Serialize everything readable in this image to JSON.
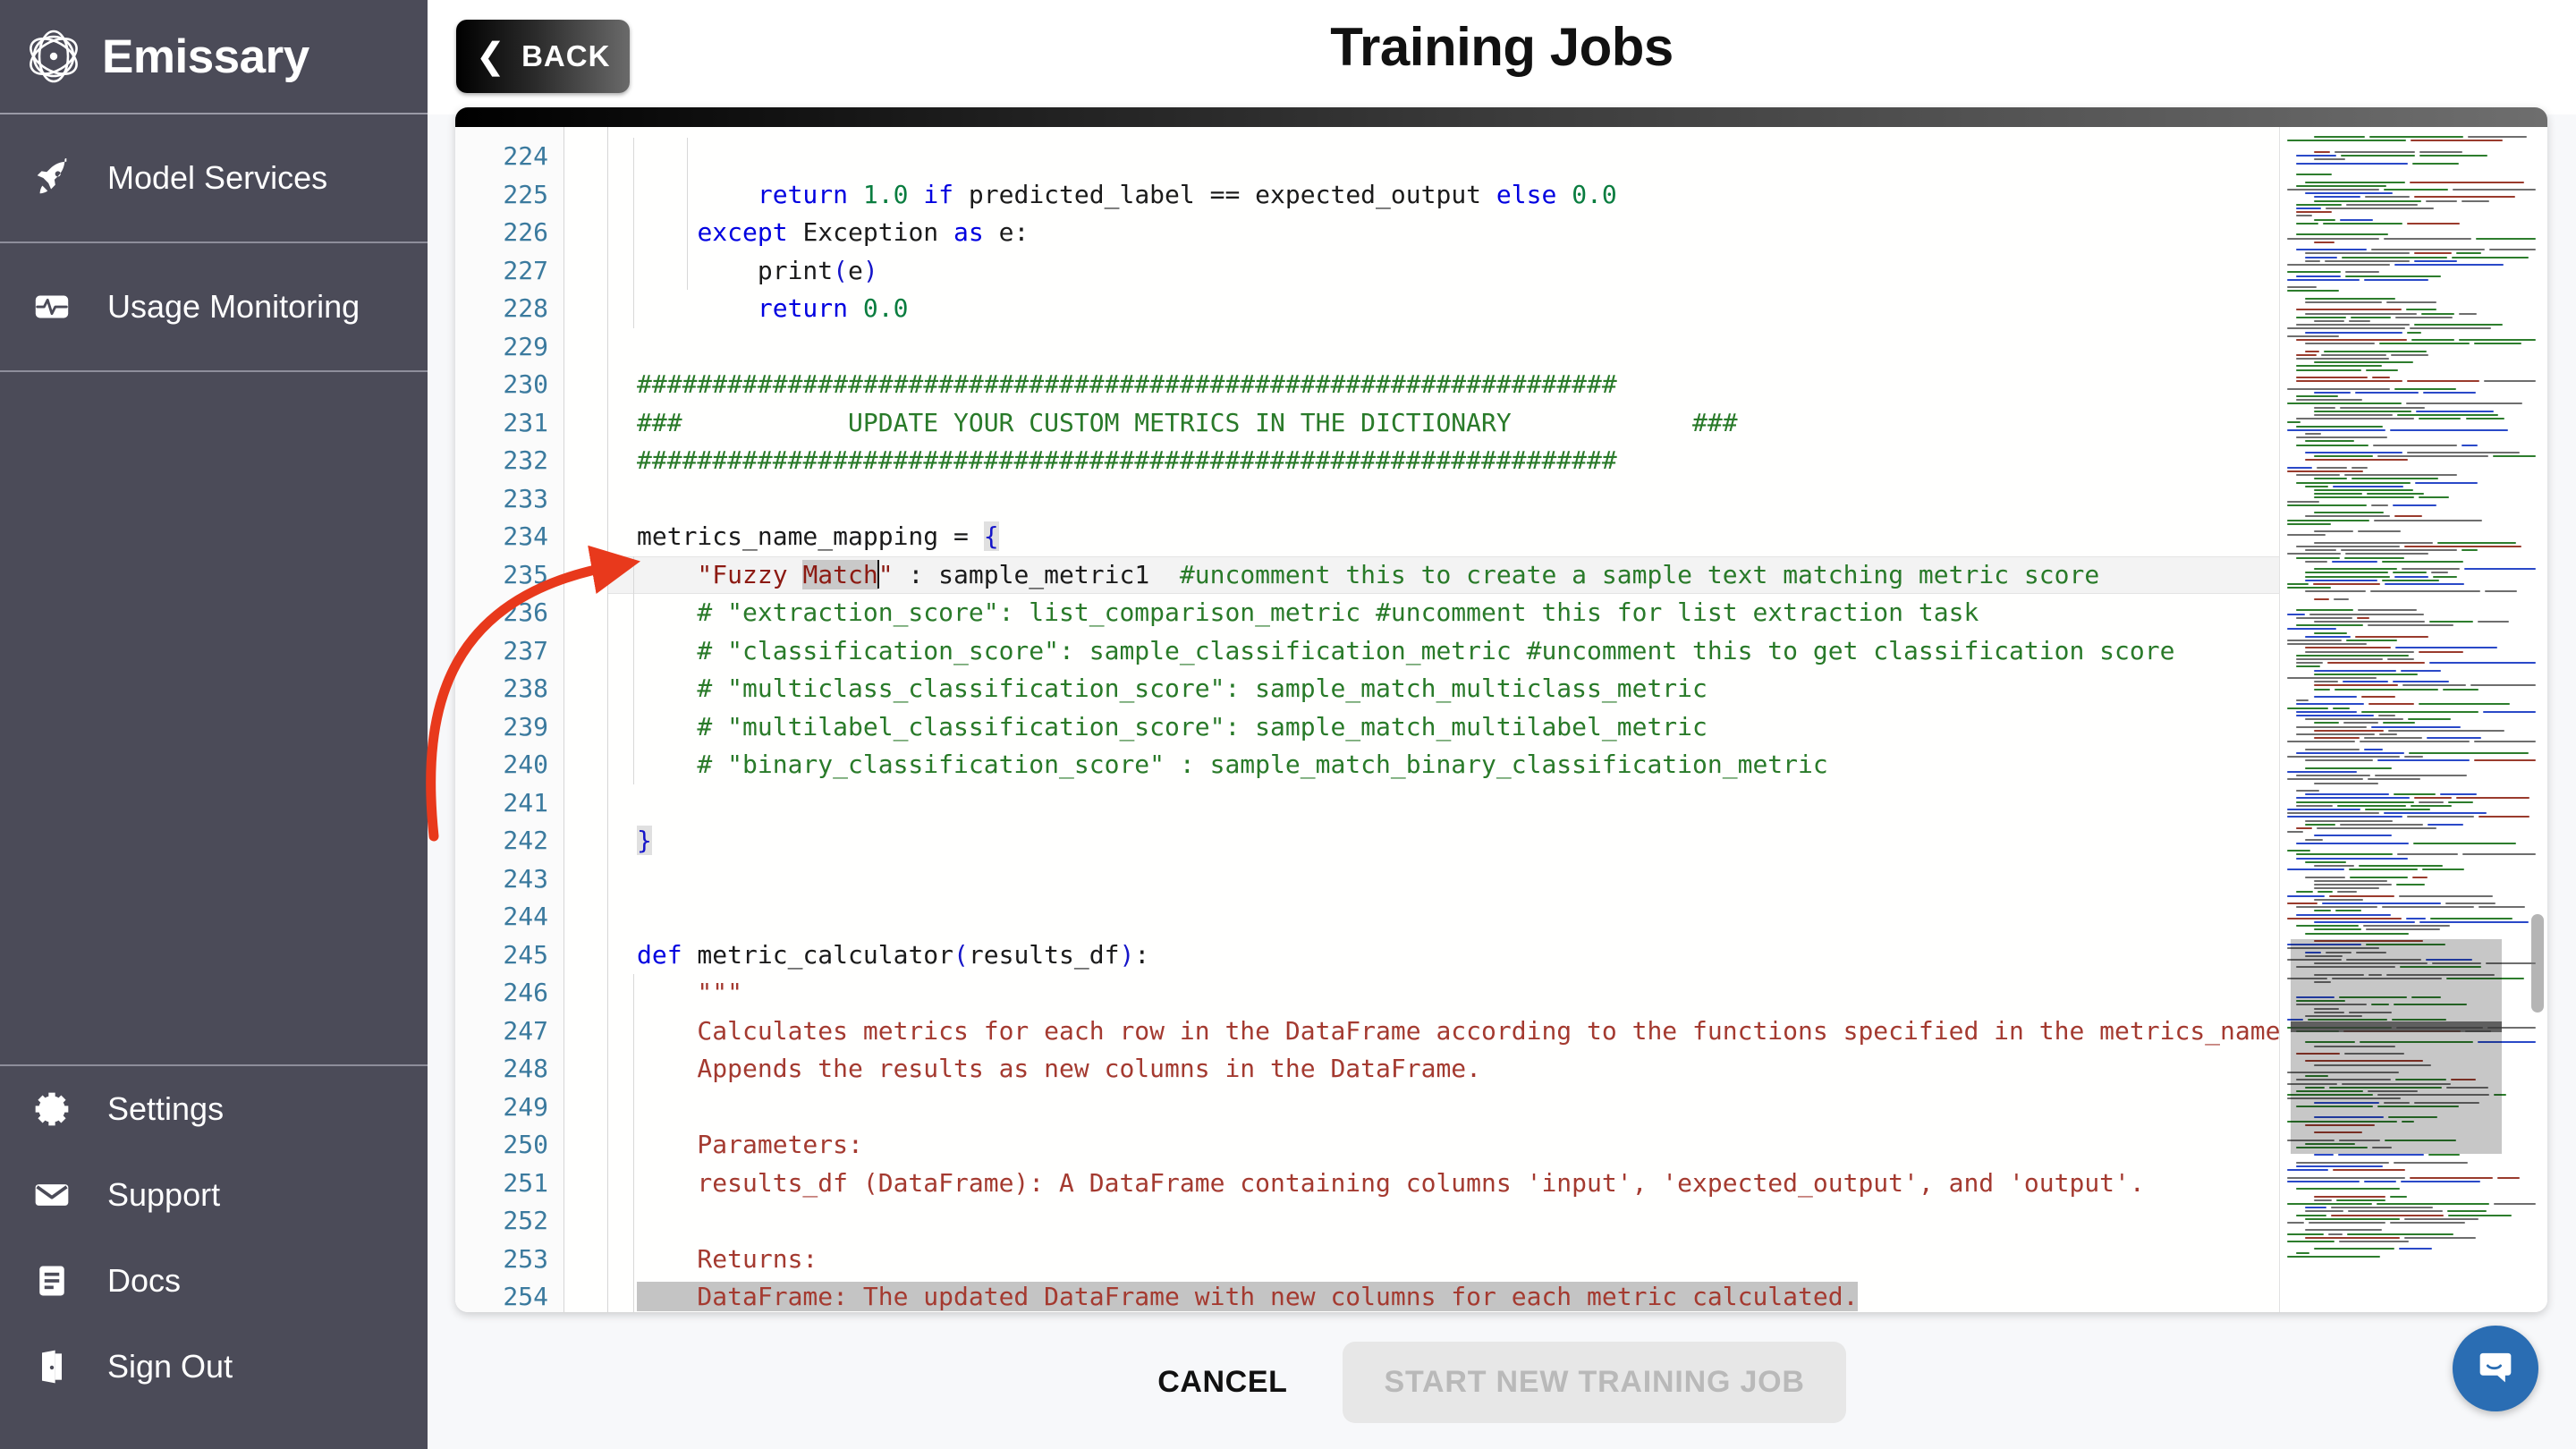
{
  "app": {
    "brand_name": "Emissary",
    "brand_icon": "atom-icon"
  },
  "sidebar": {
    "primary_items": [
      {
        "label": "Model Services",
        "icon": "rocket-icon"
      },
      {
        "label": "Usage Monitoring",
        "icon": "activity-monitor-icon"
      }
    ],
    "secondary_items": [
      {
        "label": "Settings",
        "icon": "gear-icon"
      },
      {
        "label": "Support",
        "icon": "envelope-icon"
      },
      {
        "label": "Docs",
        "icon": "document-icon"
      },
      {
        "label": "Sign Out",
        "icon": "exit-door-icon"
      }
    ]
  },
  "header": {
    "title": "Training Jobs",
    "back_label": "BACK",
    "back_icon": "chevron-left-icon"
  },
  "footer": {
    "cancel_label": "CANCEL",
    "start_label": "START NEW TRAINING JOB",
    "start_disabled": true
  },
  "chat": {
    "icon": "intercom-chat-icon",
    "color": "#2a6db3"
  },
  "editor": {
    "language": "python",
    "first_visible_line": 224,
    "last_visible_line": 254,
    "cursor_line": 235,
    "selected_word": "Match",
    "selection_highlight_line": 254,
    "colors": {
      "keyword": "#0000e0",
      "number": "#0a7d3f",
      "comment": "#297a29",
      "string": "#8c1a12",
      "docstring": "#a43a30",
      "line_number": "#3b7a9e",
      "current_line_bg": "#f3f3f3",
      "selection_bg": "#c4c4c4"
    },
    "lines": [
      {
        "n": 224,
        "text": ""
      },
      {
        "n": 225,
        "text": "        return 1.0 if predicted_label == expected_output else 0.0"
      },
      {
        "n": 226,
        "text": "    except Exception as e:"
      },
      {
        "n": 227,
        "text": "        print(e)"
      },
      {
        "n": 228,
        "text": "        return 0.0"
      },
      {
        "n": 229,
        "text": ""
      },
      {
        "n": 230,
        "text": "#################################################################"
      },
      {
        "n": 231,
        "text": "###           UPDATE YOUR CUSTOM METRICS IN THE DICTIONARY            ###"
      },
      {
        "n": 232,
        "text": "#################################################################"
      },
      {
        "n": 233,
        "text": ""
      },
      {
        "n": 234,
        "text": "metrics_name_mapping = {"
      },
      {
        "n": 235,
        "text": "    \"Fuzzy Match\" : sample_metric1  #uncomment this to create a sample text matching metric score"
      },
      {
        "n": 236,
        "text": "    # \"extraction_score\": list_comparison_metric #uncomment this for list extraction task"
      },
      {
        "n": 237,
        "text": "    # \"classification_score\": sample_classification_metric #uncomment this to get classification score"
      },
      {
        "n": 238,
        "text": "    # \"multiclass_classification_score\": sample_match_multiclass_metric"
      },
      {
        "n": 239,
        "text": "    # \"multilabel_classification_score\": sample_match_multilabel_metric"
      },
      {
        "n": 240,
        "text": "    # \"binary_classification_score\" : sample_match_binary_classification_metric"
      },
      {
        "n": 241,
        "text": ""
      },
      {
        "n": 242,
        "text": "}"
      },
      {
        "n": 243,
        "text": ""
      },
      {
        "n": 244,
        "text": ""
      },
      {
        "n": 245,
        "text": "def metric_calculator(results_df):"
      },
      {
        "n": 246,
        "text": "    \"\"\""
      },
      {
        "n": 247,
        "text": "    Calculates metrics for each row in the DataFrame according to the functions specified in the metrics_name_m"
      },
      {
        "n": 248,
        "text": "    Appends the results as new columns in the DataFrame."
      },
      {
        "n": 249,
        "text": ""
      },
      {
        "n": 250,
        "text": "    Parameters:"
      },
      {
        "n": 251,
        "text": "    results_df (DataFrame): A DataFrame containing columns 'input', 'expected_output', and 'output'."
      },
      {
        "n": 252,
        "text": ""
      },
      {
        "n": 253,
        "text": "    Returns:"
      },
      {
        "n": 254,
        "text": "    DataFrame: The updated DataFrame with new columns for each metric calculated."
      }
    ]
  },
  "annotation": {
    "type": "red-curved-arrow",
    "color": "#e8391c",
    "points_to_line": 235
  }
}
